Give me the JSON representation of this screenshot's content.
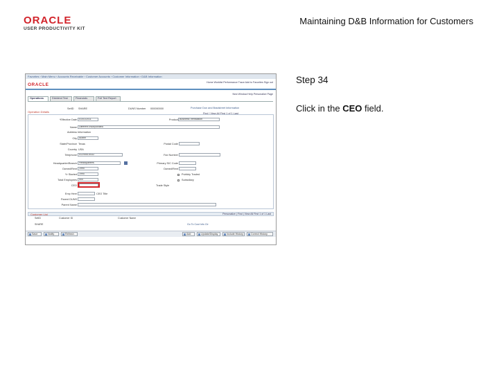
{
  "header": {
    "brand_name": "ORACLE",
    "brand_sub": "USER PRODUCTIVITY KIT",
    "doc_title": "Maintaining D&B Information for Customers"
  },
  "step": {
    "label": "Step 34",
    "instruction_prefix": "Click in the ",
    "instruction_field": "CEO",
    "instruction_suffix": " field."
  },
  "shot": {
    "breadcrumbs": "Favorites  ›  Main Menu  ›  Accounts Receivable  ›  Customer Accounts  ›  Customer Information  ›  D&B Information",
    "logo": "ORACLE",
    "links": "Home   Worklist   Performance Trace   Add to Favorites   Sign out",
    "new_window": "New Window   Help   Personalize Page",
    "tabs": [
      "Operations",
      "Dividend Test",
      "Financials",
      "Full Text Report"
    ],
    "section_title": "Operation Details",
    "setid_label": "SetID",
    "setid_value": "SHARE",
    "duns_label": "DUNS Number",
    "duns_value": "000000000",
    "purchase_link": "Purchase Dun and Bradstreet Information",
    "rownav": "Find  |  View All     First  1 of 1  Last",
    "fields": {
      "effective_date_label": "*Effective Date",
      "effective_date_value": "01/01/2011",
      "product_label": "Product",
      "product_value": "Business Verification",
      "name_label": "Name",
      "name_value": "Different Incorporated",
      "address_label": "Address Information",
      "city_label": "City",
      "city_value": "Austin",
      "state_label": "State/Province",
      "state_value": "Texas",
      "postal_label": "Postal Code",
      "country_label": "Country",
      "country_value": "USA",
      "telephone_label": "Telephone",
      "telephone_value": "512/555-5432",
      "fax_label": "Fax Number",
      "hq_label": "Headquarter/Branch",
      "hq_value": "Headquarters",
      "primary_sic_label": "Primary SIC Code",
      "owned_rent_label": "Owned/Rent",
      "owned_rent_value": "1990",
      "yr_started_label": "Yr Started",
      "yr_started_value": "1990",
      "employees_label": "Total Employees",
      "employees_value": "500",
      "ceo_label": "CEO",
      "ceo_value": "",
      "ceo_title_label": "CEO Title",
      "trade_style_label": "Trade Style",
      "trade_style_value": "",
      "rating_label": "Rating",
      "emp_here_label": "Emp Here",
      "emp_here_value": "",
      "parent_duns_label": "Parent DUNS",
      "parent_name_label": "Parent Name",
      "parent_name_value": "",
      "financial_label": "Financial Data",
      "subsidiary_label": "Subsidiary",
      "public_label": "Publicly Traded"
    },
    "grid": {
      "title": "Customer List",
      "nav": "Personalize  |  Find  |  View All     First  1 of 1  Last",
      "columns": [
        "SetID",
        "Customer ID",
        "Customer Name"
      ],
      "rows": [
        [
          "SHARE",
          "",
          "Go To Cust Info Ctr"
        ]
      ]
    },
    "toolbar": {
      "save": "Save",
      "notify": "Notify",
      "refresh": "Refresh",
      "add": "Add",
      "update_display": "Update/Display",
      "include_history": "Include History",
      "correct_history": "Correct History"
    }
  }
}
